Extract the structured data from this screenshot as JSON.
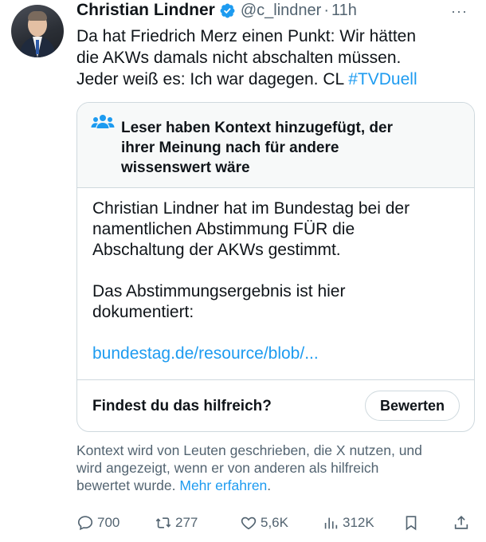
{
  "tweet": {
    "author_name": "Christian Lindner",
    "handle": "@c_lindner",
    "separator": "·",
    "time": "11h",
    "more_label": "···",
    "text_lines": [
      "Da hat Friedrich Merz einen Punkt: Wir hätten",
      "die AKWs damals nicht abschalten müssen.",
      "Jeder weiß es: Ich war dagegen. CL "
    ],
    "hashtag": "#TVDuell"
  },
  "community_note": {
    "title_lines": [
      "Leser haben Kontext hinzugefügt, der",
      "ihrer Meinung nach für andere",
      "wissenswert wäre"
    ],
    "body_p1": [
      "Christian Lindner hat im Bundestag bei der",
      "namentlichen Abstimmung FÜR die",
      "Abschaltung der AKWs gestimmt."
    ],
    "body_p2": [
      "Das Abstimmungsergebnis ist hier",
      "dokumentiert:"
    ],
    "link": "bundestag.de/resource/blob/...",
    "helpful_question": "Findest du das hilfreich?",
    "rate_button": "Bewerten"
  },
  "context_info": {
    "lines": [
      "Kontext wird von Leuten geschrieben, die X nutzen, und",
      "wird angezeigt, wenn er von anderen als hilfreich",
      "bewertet wurde. "
    ],
    "learn_more": "Mehr erfahren",
    "trailing": "."
  },
  "actions": {
    "replies": "700",
    "reposts": "277",
    "likes": "5,6K",
    "views": "312K"
  },
  "colors": {
    "accent": "#1d9bf0",
    "secondary_text": "#536471",
    "border": "#cfd9de",
    "verified": "#1d9bf0"
  },
  "icons": {
    "verified": "verified-badge-icon",
    "note": "people-icon",
    "reply": "reply-icon",
    "repost": "repost-icon",
    "like": "heart-icon",
    "views": "views-icon",
    "bookmark": "bookmark-icon",
    "share": "share-icon"
  }
}
